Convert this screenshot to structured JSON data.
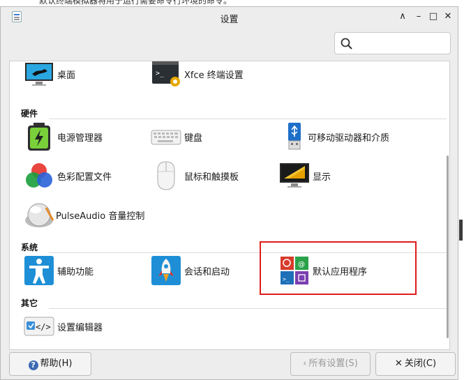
{
  "background_text": "默认终端模拟器将用于运行需要命令行环境的命令。",
  "window": {
    "title": "设置",
    "buttons": [
      "∧",
      "–",
      "□",
      "✕"
    ]
  },
  "search": {
    "value": "",
    "placeholder": ""
  },
  "categories": {
    "hardware": "硬件",
    "system": "系统",
    "other": "其它"
  },
  "items": {
    "desktop": "桌面",
    "xfce_terminal": "Xfce 终端设置",
    "power_manager": "电源管理器",
    "keyboard": "键盘",
    "removable_drives": "可移动驱动器和介质",
    "color_profiles": "色彩配置文件",
    "mouse_touchpad": "鼠标和触摸板",
    "display": "显示",
    "pulseaudio": "PulseAudio 音量控制",
    "accessibility": "辅助功能",
    "session_startup": "会话和启动",
    "default_apps": "默认应用程序",
    "settings_editor": "设置编辑器"
  },
  "footer": {
    "help": "帮助(H)",
    "all_settings": "所有设置(S)",
    "close": "关闭(C)"
  },
  "colors": {
    "highlight_border": "#e01b1b",
    "accent": "#3d6ab3"
  }
}
